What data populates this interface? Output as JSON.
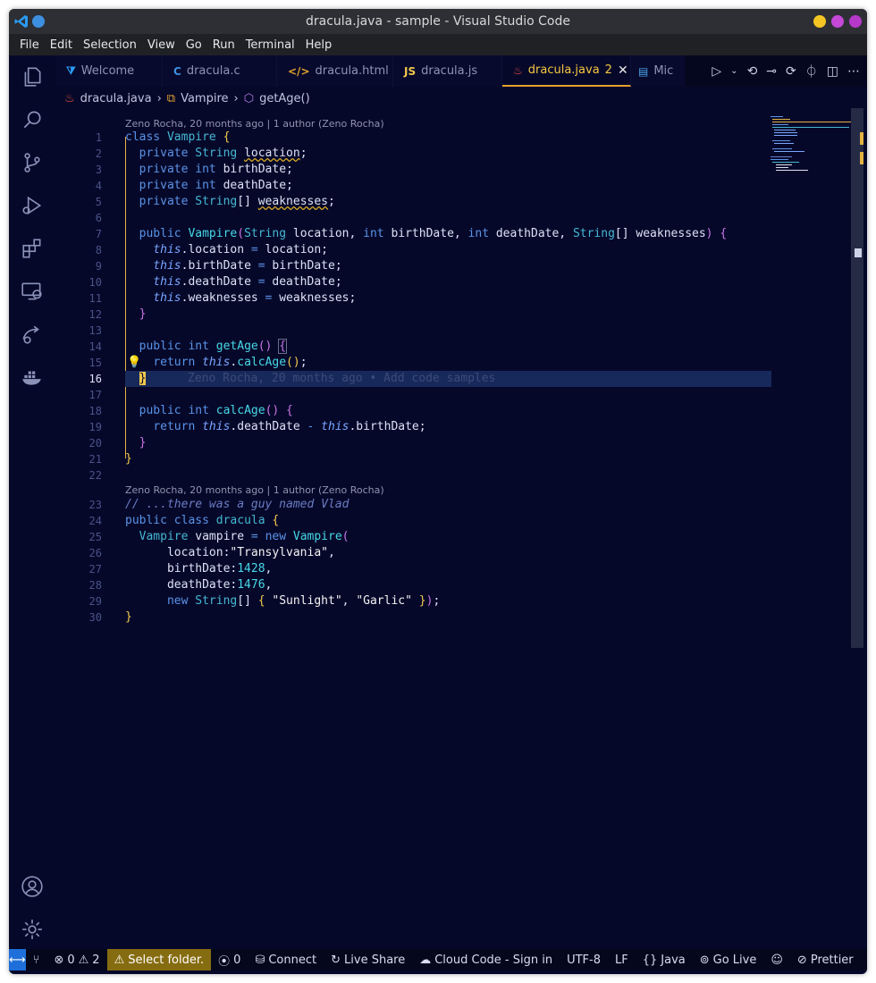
{
  "window": {
    "title": "dracula.java - sample - Visual Studio Code"
  },
  "menu": [
    "File",
    "Edit",
    "Selection",
    "View",
    "Go",
    "Run",
    "Terminal",
    "Help"
  ],
  "tabs": [
    {
      "label": "Welcome",
      "icon": "vscode-icon",
      "icon_char": ""
    },
    {
      "label": "dracula.c",
      "icon": "c-file-icon",
      "icon_char": "C"
    },
    {
      "label": "dracula.html",
      "icon": "html-file-icon",
      "icon_char": "</>"
    },
    {
      "label": "dracula.js",
      "icon": "js-file-icon",
      "icon_char": "JS"
    },
    {
      "label": "dracula.java",
      "badge": "2",
      "icon": "java-file-icon",
      "icon_char": ""
    },
    {
      "label": "Mic",
      "icon": "file-icon",
      "icon_char": ""
    }
  ],
  "breadcrumb": {
    "file": "dracula.java",
    "class": "Vampire",
    "method": "getAge()"
  },
  "codelens": [
    {
      "text": "Zeno Rocha, 20 months ago | 1 author (Zeno Rocha)"
    },
    {
      "text": "Zeno Rocha, 20 months ago | 1 author (Zeno Rocha)"
    }
  ],
  "line_numbers": [
    "1",
    "2",
    "3",
    "4",
    "5",
    "6",
    "7",
    "8",
    "9",
    "10",
    "11",
    "12",
    "13",
    "14",
    "15",
    "16",
    "17",
    "18",
    "19",
    "20",
    "21",
    "22",
    "23",
    "24",
    "25",
    "26",
    "27",
    "28",
    "29",
    "30"
  ],
  "inline_blame": "Zeno Rocha, 20 months ago • Add code samples",
  "status": {
    "errors": "0",
    "warnings": "2",
    "select_folder": "Select folder.",
    "ports": "0",
    "connect": "Connect",
    "live_share": "Live Share",
    "cloud_code": "Cloud Code - Sign in",
    "encoding": "UTF-8",
    "eol": "LF",
    "language": "Java",
    "go_live": "Go Live",
    "prettier": "Prettier"
  },
  "colors": {
    "background": "#06082a",
    "keyword": "#5a93e6",
    "type": "#45b7d1",
    "bracket": "#f2c94c",
    "active_tab": "#f5c842",
    "remote": "#1e6fd9",
    "warning_bg": "#866c10"
  }
}
